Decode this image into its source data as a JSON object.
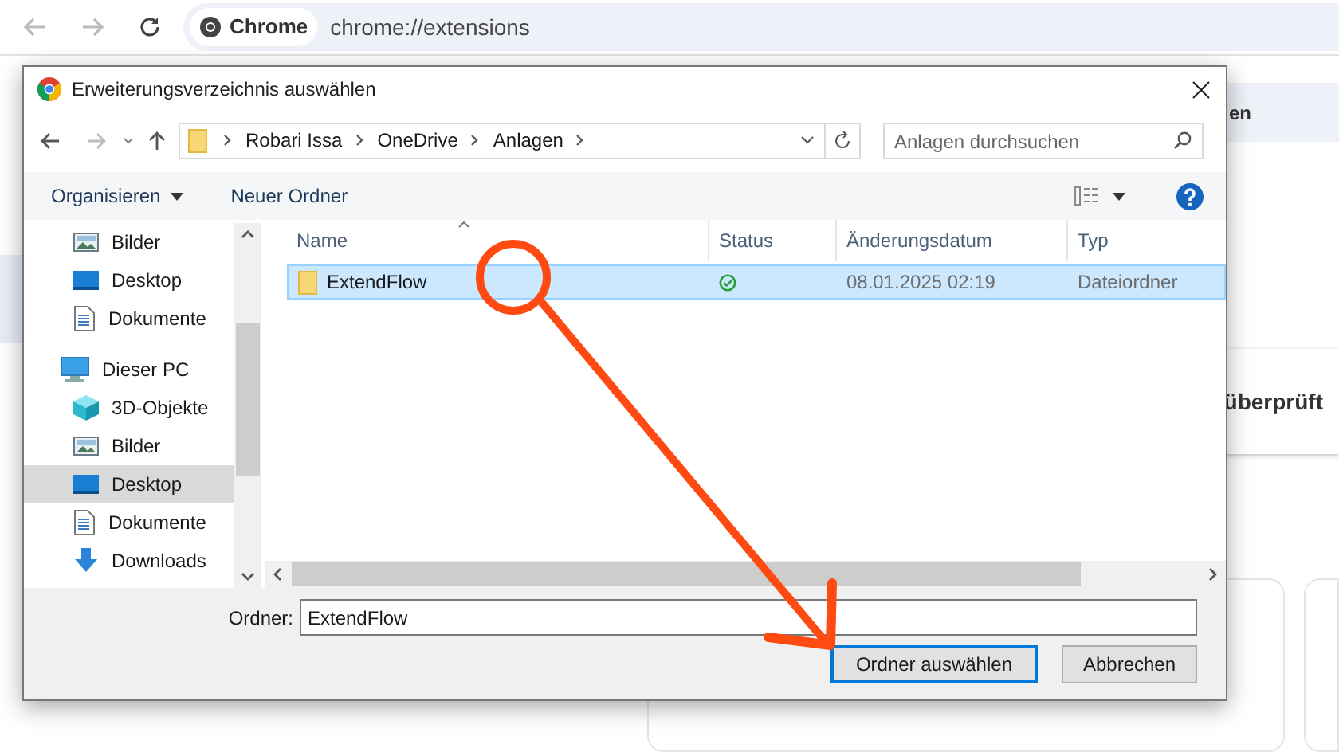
{
  "browser": {
    "site_chip": "Chrome",
    "url": "chrome://extensions"
  },
  "page_behind": {
    "texts": [
      "en",
      "überprüft"
    ]
  },
  "dialog": {
    "title": "Erweiterungsverzeichnis auswählen",
    "breadcrumbs": [
      "Robari Issa",
      "OneDrive",
      "Anlagen"
    ],
    "search": {
      "placeholder": "Anlagen durchsuchen"
    },
    "toolbar": {
      "organize": "Organisieren",
      "new_folder": "Neuer Ordner"
    },
    "nav_pane": {
      "continued_children": [
        {
          "label": "Bilder",
          "kind": "pictures",
          "selected": false
        },
        {
          "label": "Desktop",
          "kind": "desktop",
          "selected": false
        },
        {
          "label": "Dokumente",
          "kind": "documents",
          "selected": false
        }
      ],
      "tree": [
        {
          "label": "Dieser PC",
          "kind": "pc",
          "selected": false,
          "children": [
            {
              "label": "3D-Objekte",
              "kind": "objects3d",
              "selected": false
            },
            {
              "label": "Bilder",
              "kind": "pictures",
              "selected": false
            },
            {
              "label": "Desktop",
              "kind": "desktop",
              "selected": true
            },
            {
              "label": "Dokumente",
              "kind": "documents",
              "selected": false
            },
            {
              "label": "Downloads",
              "kind": "downloads",
              "selected": false
            }
          ]
        }
      ]
    },
    "columns": [
      "Name",
      "Status",
      "Änderungsdatum",
      "Typ"
    ],
    "rows": [
      {
        "name": "ExtendFlow",
        "synced": true,
        "date": "08.01.2025 02:19",
        "type": "Dateiordner",
        "selected": true
      }
    ],
    "folder_field": {
      "label": "Ordner:",
      "value": "ExtendFlow"
    },
    "buttons": [
      {
        "label": "Ordner auswählen",
        "default": true
      },
      {
        "label": "Abbrechen",
        "default": false
      }
    ]
  }
}
